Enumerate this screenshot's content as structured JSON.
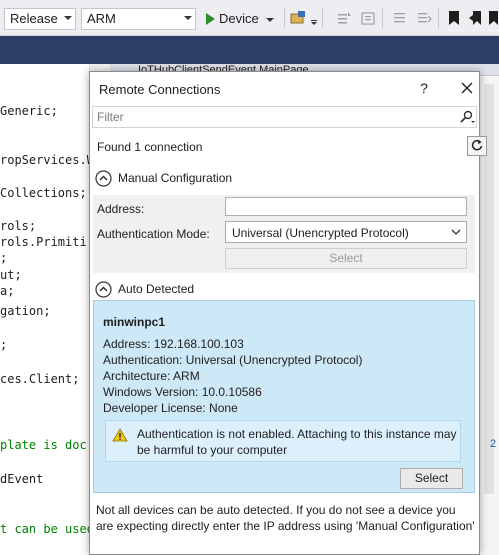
{
  "toolbar": {
    "config_value": "Release",
    "platform_value": "ARM",
    "run_label": "Device"
  },
  "editor": {
    "tab_title": "IoTHubClientSendEvent.MainPage",
    "lines": [
      {
        "text": "Generic;",
        "comment": false
      },
      {
        "text": "ropServices.W",
        "comment": false
      },
      {
        "text": "Collections;",
        "comment": false
      },
      {
        "text": "rols;",
        "comment": false
      },
      {
        "text": "rols.Primiti",
        "comment": false
      },
      {
        "text": ";",
        "comment": false
      },
      {
        "text": "ut;",
        "comment": false
      },
      {
        "text": "a;",
        "comment": false
      },
      {
        "text": "gation;",
        "comment": false
      },
      {
        "text": ";",
        "comment": false
      },
      {
        "text": "ces.Client;",
        "comment": false
      },
      {
        "text": "plate is doc",
        "comment": true
      },
      {
        "text": "dEvent",
        "comment": false
      },
      {
        "text": "t can be used",
        "comment": true
      }
    ],
    "right_number": "2"
  },
  "dialog": {
    "title": "Remote Connections",
    "help": "?",
    "filter_placeholder": "Filter",
    "found_text": "Found 1 connection",
    "manual": {
      "header": "Manual Configuration",
      "address_label": "Address:",
      "address_value": "",
      "auth_label": "Authentication Mode:",
      "auth_value": "Universal (Unencrypted Protocol)",
      "select_label": "Select"
    },
    "auto": {
      "header": "Auto Detected",
      "host": "minwinpc1",
      "address": "Address:  192.168.100.103",
      "authentication": "Authentication:  Universal (Unencrypted Protocol)",
      "architecture": "Architecture:  ARM",
      "windows_version": "Windows Version:  10.0.10586",
      "developer_license": "Developer License:  None",
      "warning": "Authentication is not enabled. Attaching to this instance may be harmful to your computer",
      "select_label": "Select"
    },
    "footnote": "Not all devices can be auto detected. If you do not see a device you are expecting directly enter the IP address using 'Manual Configuration'"
  },
  "colors": {
    "accent_band": "#2d3e66",
    "auto_panel": "#cde8f7",
    "warning_yellow": "#f5c518",
    "run_green": "#2e8b2e"
  }
}
